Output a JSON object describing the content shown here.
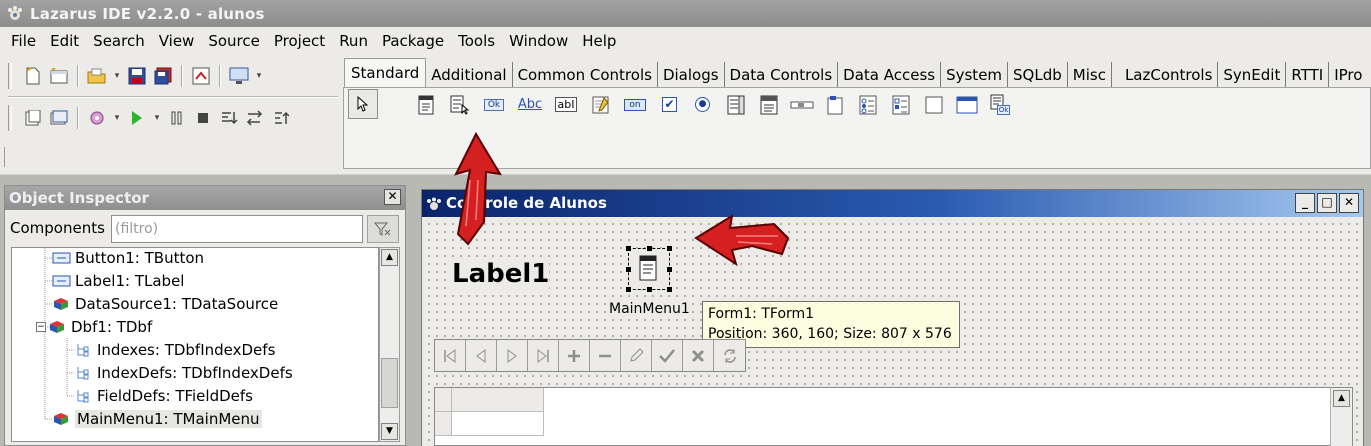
{
  "window": {
    "title": "Lazarus IDE v2.2.0 - alunos",
    "app_icon": "lazarus-paw-icon"
  },
  "menu": [
    "File",
    "Edit",
    "Search",
    "View",
    "Source",
    "Project",
    "Run",
    "Package",
    "Tools",
    "Window",
    "Help"
  ],
  "toolbar": {
    "row1": [
      "new-unit-icon",
      "new-form-icon",
      "open-icon",
      "save-icon",
      "save-all-icon",
      "toggle-form-unit-icon",
      "view-forms-icon"
    ],
    "row2": [
      "view-units-icon",
      "view-forms-list-icon",
      "build-icon",
      "run-icon",
      "pause-icon",
      "stop-icon",
      "step-into-icon",
      "step-over-icon",
      "step-out-icon"
    ]
  },
  "palette": {
    "tabs": [
      "Standard",
      "Additional",
      "Common Controls",
      "Dialogs",
      "Data Controls",
      "Data Access",
      "System",
      "SQLdb",
      "Misc",
      "LazControls",
      "SynEdit",
      "RTTI",
      "IPro"
    ],
    "active_tab": "Standard",
    "components": [
      {
        "icon": "tmainmenu-icon",
        "text": ""
      },
      {
        "icon": "tpopupmenu-icon",
        "text": ""
      },
      {
        "icon": "tbutton-icon",
        "text": "Ok"
      },
      {
        "icon": "tlabel-icon",
        "text": "Abc"
      },
      {
        "icon": "tedit-icon",
        "text": "abI"
      },
      {
        "icon": "tmemo-icon",
        "text": ""
      },
      {
        "icon": "ttogglebox-icon",
        "text": "on"
      },
      {
        "icon": "tcheckbox-icon",
        "text": "✔"
      },
      {
        "icon": "tradiobutton-icon",
        "text": "●"
      },
      {
        "icon": "tlistbox-icon",
        "text": ""
      },
      {
        "icon": "tcombobox-icon",
        "text": ""
      },
      {
        "icon": "tscrollbar-icon",
        "text": ""
      },
      {
        "icon": "tgroupbox-icon",
        "text": ""
      },
      {
        "icon": "tradiogroup-icon",
        "text": ""
      },
      {
        "icon": "tcheckgroup-icon",
        "text": ""
      },
      {
        "icon": "tpanel-icon",
        "text": ""
      },
      {
        "icon": "tframe-icon",
        "text": ""
      },
      {
        "icon": "tactionlist-icon",
        "text": "Ok"
      }
    ]
  },
  "object_inspector": {
    "title": "Object Inspector",
    "components_label": "Components",
    "filter_placeholder": "(filtro)",
    "tree": [
      {
        "label": "Button1: TButton",
        "icon": "tbutton-icon",
        "level": 1
      },
      {
        "label": "Label1: TLabel",
        "icon": "tlabel-icon",
        "level": 1
      },
      {
        "label": "DataSource1: TDataSource",
        "icon": "datasource-icon",
        "level": 1
      },
      {
        "label": "Dbf1: TDbf",
        "icon": "dbf-icon",
        "level": 1,
        "expanded": true
      },
      {
        "label": "Indexes: TDbfIndexDefs",
        "icon": "collection-icon",
        "level": 2
      },
      {
        "label": "IndexDefs: TDbfIndexDefs",
        "icon": "collection-icon",
        "level": 2
      },
      {
        "label": "FieldDefs: TFieldDefs",
        "icon": "collection-icon",
        "level": 2
      },
      {
        "label": "MainMenu1: TMainMenu",
        "icon": "mainmenu-icon",
        "level": 1,
        "selected": true
      }
    ]
  },
  "form": {
    "title": "Controle de Alunos",
    "label1_text": "Label1",
    "mainmenu_caption": "MainMenu1",
    "hint_line1": "Form1: TForm1",
    "hint_line2": "Position: 360, 160; Size: 807 x 576",
    "navigator_buttons": [
      "first-icon",
      "prior-icon",
      "next-icon",
      "last-icon",
      "insert-icon",
      "delete-icon",
      "edit-icon",
      "post-icon",
      "cancel-icon",
      "refresh-icon"
    ]
  },
  "colors": {
    "annotation_arrow": "#d42020",
    "form_title_gradient_start": "#0a246a",
    "hint_bg": "#fdfde0"
  }
}
